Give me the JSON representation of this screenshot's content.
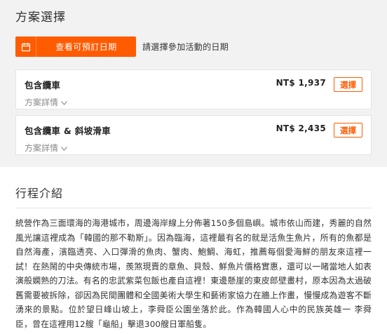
{
  "plans_section": {
    "title": "方案選擇",
    "date_button_label": "查看可預訂日期",
    "date_hint": "請選擇參加活動的日期"
  },
  "plans": [
    {
      "name": "包含纜車",
      "price": "NT$ 1,937",
      "details_label": "方案詳情",
      "select_label": "選擇"
    },
    {
      "name": "包含纜車 & 斜坡滑車",
      "price": "NT$ 2,435",
      "details_label": "方案詳情",
      "select_label": "選擇"
    }
  ],
  "itinerary": {
    "title": "行程介紹",
    "body": "統營作為三面環海的海港城市，周邊海岸線上分佈著150多個島嶼。城市依山而建，秀麗的自然風光讓這裡成為「韓國的那不勒斯」。因為臨海，這裡最有名的就是活魚生魚片，所有的魚都是自然海產，濱臨透亮、入口彈滑的魚肉、蟹肉、鮑鯛、海虹，推薦每個愛海鮮的朋友來這裡一試！在熱鬧的中央傳統市場，羨煞現賣的章魚、貝殼、鮮魚片價格實惠，還可以一睹當地人如表演般嫻熟的刀法。有名的忠武紫菜包飯也產自這裡！東邊懸崖的東皮郎壁畫村，原本因為太過破舊需要被拆除，卻因為民間團體和全國美術大學生和藝術家協力在牆上作畫，慢慢成為遊客不斷湧來的景點。位於望日峰山坡上，李舜臣公園坐落於此。作為韓國人心中的民族英雄一 李舜臣，曾在這裡用12艘「龜船」擊退300艘日軍船隻。"
  },
  "colors": {
    "accent": "#ff5b00",
    "section_bg": "#f2f2f2"
  },
  "icons": {
    "calendar": "calendar-icon",
    "chevron": "chevron-down-icon"
  }
}
